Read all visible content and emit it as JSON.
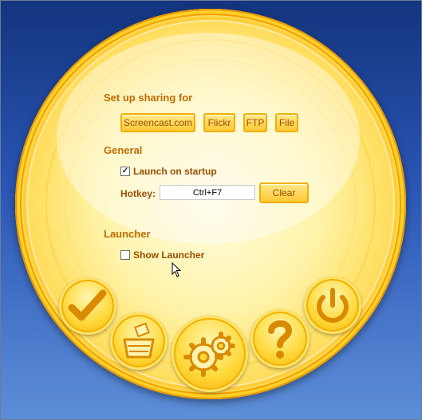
{
  "sharing": {
    "heading": "Set up sharing for",
    "buttons": [
      {
        "label": "Screencast.com"
      },
      {
        "label": "Flickr"
      },
      {
        "label": "FTP"
      },
      {
        "label": "File"
      }
    ]
  },
  "general": {
    "heading": "General",
    "launch_on_startup": {
      "label": "Launch on startup",
      "checked": true
    },
    "hotkey_label": "Hotkey:",
    "hotkey_value": "Ctrl+F7",
    "clear_label": "Clear"
  },
  "launcher": {
    "heading": "Launcher",
    "show_launcher": {
      "label": "Show Launcher",
      "checked": false
    }
  },
  "icons": {
    "ok": "checkmark-icon",
    "capture": "capture-tray-icon",
    "settings": "gears-icon",
    "help": "question-mark-icon",
    "power": "power-icon"
  },
  "colors": {
    "accent": "#c06a00",
    "background_top": "#14357e",
    "background_bottom": "#5d8ed8",
    "disc": "#ffd84a"
  }
}
